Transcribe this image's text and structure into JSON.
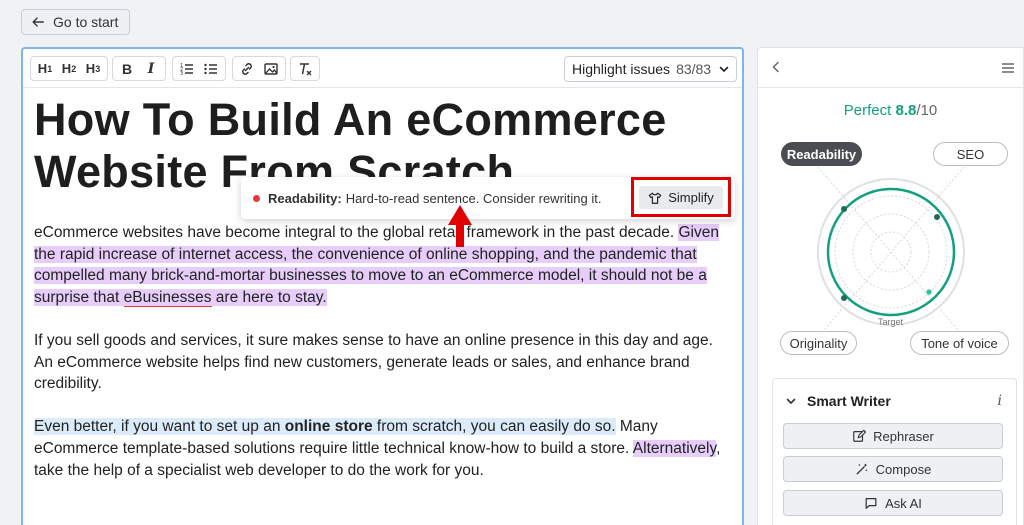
{
  "header": {
    "back_label": "Go to start"
  },
  "toolbar": {
    "h1": "H",
    "h1_sub": "1",
    "h2": "H",
    "h2_sub": "2",
    "h3": "H",
    "h3_sub": "3",
    "bold": "B",
    "italic": "I",
    "highlight_label": "Highlight issues",
    "highlight_count": "83/83"
  },
  "document": {
    "title": "How To Build An eCommerce Website From Scratch",
    "p1_a": "eCommerce websites have become integral to the global retail framework in the past decade. ",
    "p1_b": "Given the rapid increase of internet access, the convenience of online shopping, and the pandemic that compelled many brick-and-mortar businesses to move to an eCommerce model, it should not be a surprise that ",
    "p1_c": "eBusinesses",
    "p1_d": " are here to stay.",
    "p2": "If you sell goods and services, it sure makes sense to have an online presence in this day and age. An eCommerce website helps find new customers, generate leads or sales, and enhance brand credibility.",
    "p3_a": "Even better, if you want to set up an ",
    "p3_b": "online store",
    "p3_c": " from scratch, you can easily do so.",
    "p3_d": " Many eCommerce template-based solutions require little technical know-how to build a store. ",
    "p3_e": "Alternatively",
    "p3_f": ", take the help of a specialist web developer to do the work for you."
  },
  "tooltip": {
    "category": "Readability:",
    "message": "Hard-to-read sentence. Consider rewriting it.",
    "action": "Simplify"
  },
  "panel": {
    "score_label": "Perfect",
    "score_value": "8.8",
    "score_max": "/10",
    "tabs": {
      "readability": "Readability",
      "seo": "SEO",
      "originality": "Originality",
      "tone": "Tone of voice"
    },
    "target_label": "Target",
    "smart_writer": {
      "title": "Smart Writer",
      "info": "i",
      "rephraser": "Rephraser",
      "compose": "Compose",
      "ask_ai": "Ask AI"
    }
  },
  "colors": {
    "accent_green": "#12a07f",
    "highlight_purple": "#e6cdfa",
    "highlight_blue": "#dcebf9",
    "alert_red": "#e00000"
  }
}
